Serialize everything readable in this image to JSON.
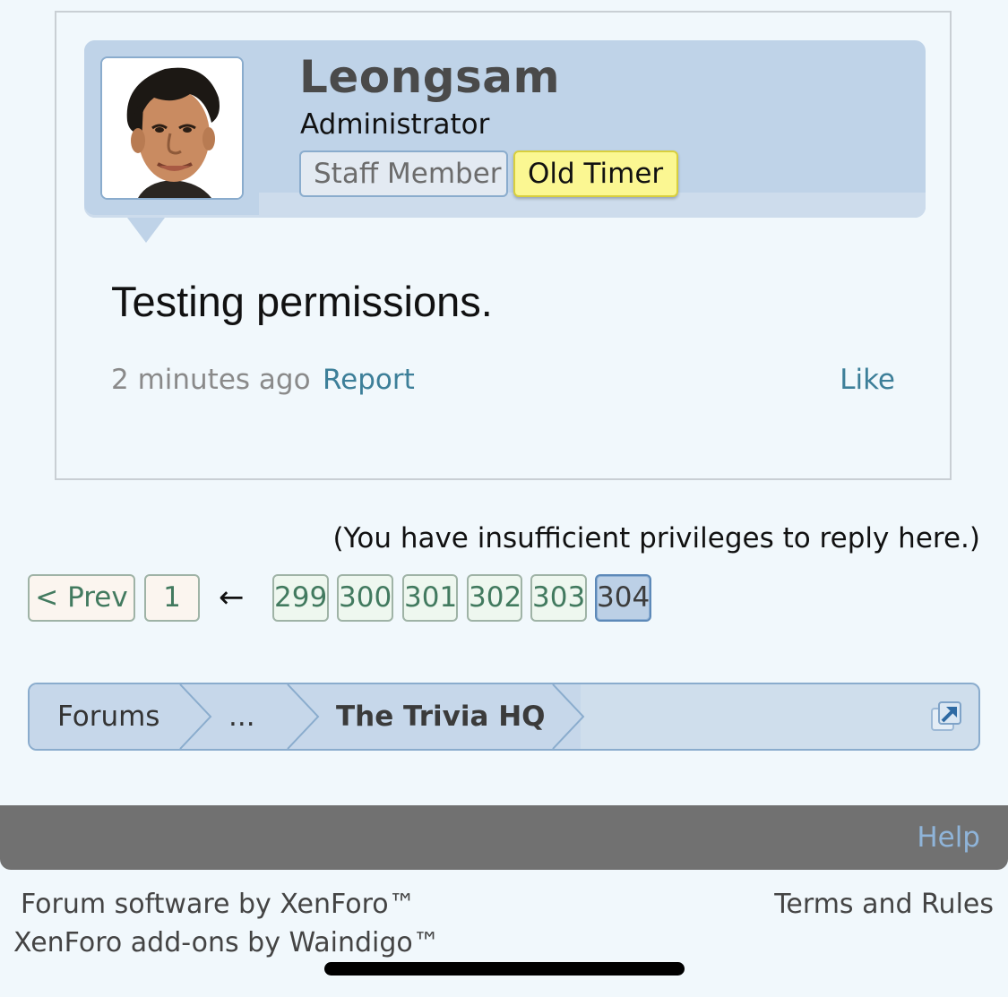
{
  "post": {
    "username": "Leongsam",
    "user_title": "Administrator",
    "badges": {
      "staff": "Staff Member",
      "old_timer": "Old Timer"
    },
    "message": "Testing permissions.",
    "time": "2 minutes ago",
    "report_label": "Report",
    "like_label": "Like"
  },
  "reply_notice": "(You have insufficient privileges to reply here.)",
  "pagination": {
    "prev_label": "< Prev",
    "first_page": "1",
    "skip_arrow": "←",
    "pages": [
      "299",
      "300",
      "301",
      "302",
      "303",
      "304"
    ],
    "current_page": "304"
  },
  "breadcrumb": {
    "items": [
      "Forums",
      "...",
      "The Trivia HQ"
    ],
    "popout_icon": "popout-arrow-icon"
  },
  "footer": {
    "help_label": "Help",
    "credit_line1": "Forum software by XenForo™",
    "credit_line2": "XenForo add-ons by Waindigo™",
    "terms_label": "Terms and Rules"
  },
  "colors": {
    "accent_link": "#3d7f99",
    "userbar_bg": "#bfd3e8",
    "old_timer_badge": "#fbf792",
    "footer_bar": "#717171"
  }
}
